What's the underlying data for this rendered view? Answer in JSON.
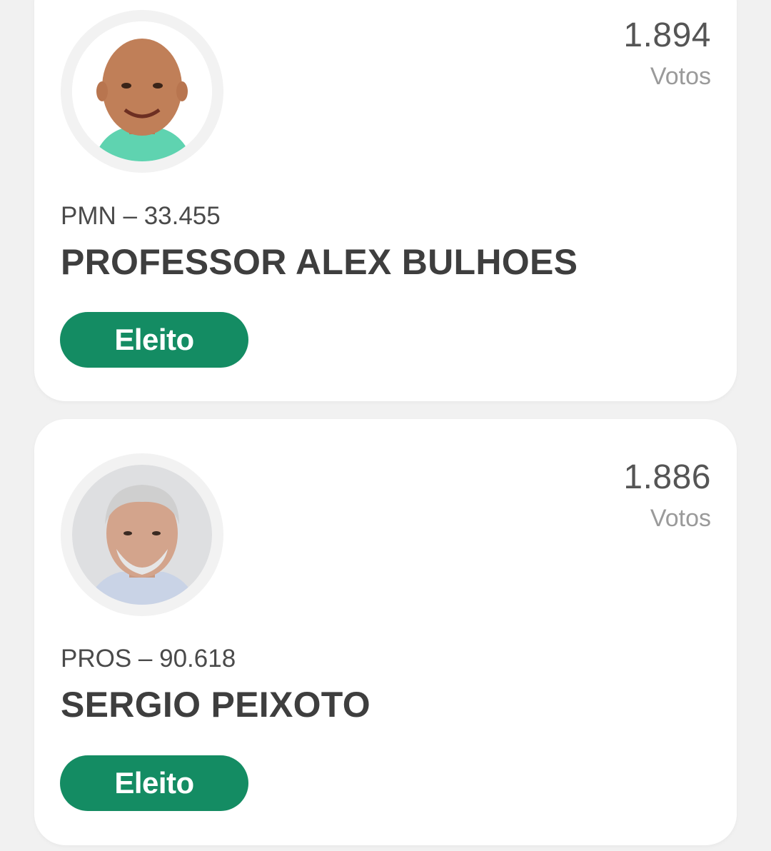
{
  "candidates": [
    {
      "party_line": "PMN – 33.455",
      "name": "PROFESSOR ALEX BULHOES",
      "votes": "1.894",
      "votes_label": "Votos",
      "status": "Eleito"
    },
    {
      "party_line": "PROS – 90.618",
      "name": "SERGIO PEIXOTO",
      "votes": "1.886",
      "votes_label": "Votos",
      "status": "Eleito"
    }
  ],
  "colors": {
    "badge_green": "#148c63",
    "card_background": "#ffffff",
    "page_background": "#f1f1f1"
  }
}
